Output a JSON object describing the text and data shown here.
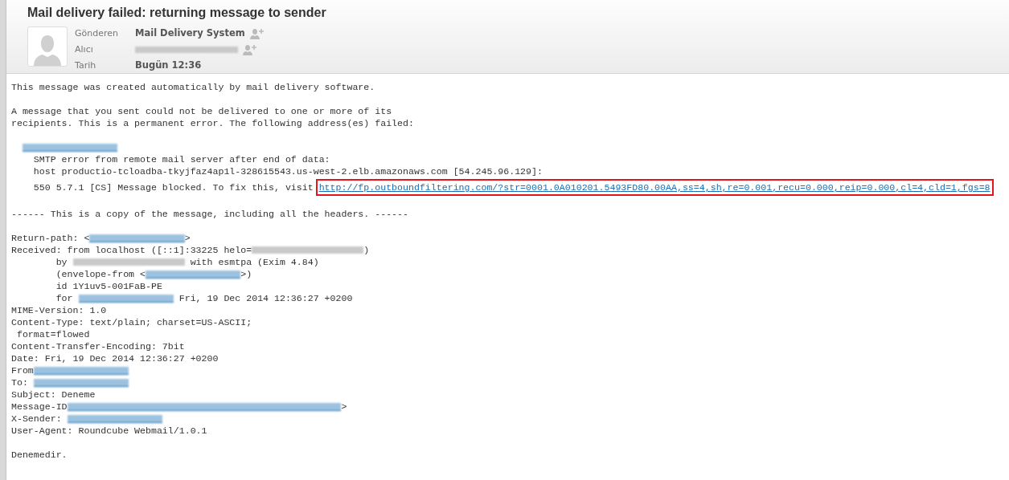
{
  "header": {
    "title": "Mail delivery failed: returning message to sender",
    "fields": [
      {
        "label": "Gönderen",
        "value": {
          "kind": "text",
          "text": "Mail Delivery System"
        },
        "add_contact": true
      },
      {
        "label": "Alıcı",
        "value": {
          "kind": "redacted_address"
        },
        "add_contact": true
      },
      {
        "label": "Tarih",
        "value": {
          "kind": "text",
          "text": "Bugün 12:36"
        },
        "add_contact": false
      }
    ]
  },
  "body": {
    "paragraphs": [
      {
        "lines": [
          [
            {
              "kind": "text",
              "text": "This message was created automatically by mail delivery software."
            }
          ]
        ]
      },
      {
        "lines": [
          [
            {
              "kind": "text",
              "text": "A message that you sent could not be delivered to one or more of its"
            }
          ],
          [
            {
              "kind": "text",
              "text": "recipients. This is a permanent error. The following address(es) failed:"
            }
          ]
        ]
      },
      {
        "lines": [
          {
            "indent": true,
            "segments": [
              {
                "kind": "redacted_address",
                "linked": true
              }
            ]
          },
          [
            {
              "kind": "text",
              "text": "    SMTP error from remote mail server after end of data:"
            }
          ],
          [
            {
              "kind": "text",
              "text": "    host productio-tcloadba-tkyjfaz4ap1l-328615543.us-west-2.elb.amazonaws.com [54.245.96.129]:"
            }
          ],
          [
            {
              "kind": "text",
              "text": "    550 5.7.1 [CS] Message blocked. To fix this, visit "
            },
            {
              "kind": "link",
              "text": "http://fp.outboundfiltering.com/?str=0001.0A010201.5493FD80.00AA,ss=4,sh,re=0.001,recu=0.000,reip=0.000,cl=4,cld=1,fgs=8",
              "highlighted": true
            }
          ]
        ]
      },
      {
        "lines": [
          [
            {
              "kind": "text",
              "text": "------ This is a copy of the message, including all the headers. ------"
            }
          ]
        ]
      },
      {
        "lines": [
          [
            {
              "kind": "text",
              "text": "Return-path: <"
            },
            {
              "kind": "redacted_address",
              "linked": true
            },
            {
              "kind": "text",
              "text": ">"
            }
          ],
          [
            {
              "kind": "text",
              "text": "Received: from localhost ([::1]:33225 helo="
            },
            {
              "kind": "redacted_host",
              "linked": false
            },
            {
              "kind": "text",
              "text": ")"
            }
          ],
          [
            {
              "kind": "text",
              "text": "        by "
            },
            {
              "kind": "redacted_host",
              "linked": false
            },
            {
              "kind": "text",
              "text": " with esmtpa (Exim 4.84)"
            }
          ],
          [
            {
              "kind": "text",
              "text": "        (envelope-from <"
            },
            {
              "kind": "redacted_address",
              "linked": true
            },
            {
              "kind": "text",
              "text": ">)"
            }
          ],
          [
            {
              "kind": "text",
              "text": "        id 1Y1uv5-001FaB-PE"
            }
          ],
          [
            {
              "kind": "text",
              "text": "        for "
            },
            {
              "kind": "redacted_address",
              "linked": true
            },
            {
              "kind": "text",
              "text": " Fri, 19 Dec 2014 12:36:27 +0200"
            }
          ],
          [
            {
              "kind": "text",
              "text": "MIME-Version: 1.0"
            }
          ],
          [
            {
              "kind": "text",
              "text": "Content-Type: text/plain; charset=US-ASCII;"
            }
          ],
          [
            {
              "kind": "text",
              "text": " format=flowed"
            }
          ],
          [
            {
              "kind": "text",
              "text": "Content-Transfer-Encoding: 7bit"
            }
          ],
          [
            {
              "kind": "text",
              "text": "Date: Fri, 19 Dec 2014 12:36:27 +0200"
            }
          ],
          [
            {
              "kind": "text",
              "text": "From"
            },
            {
              "kind": "redacted_address",
              "linked": true
            }
          ],
          [
            {
              "kind": "text",
              "text": "To: "
            },
            {
              "kind": "redacted_address",
              "linked": true
            }
          ],
          [
            {
              "kind": "text",
              "text": "Subject: Deneme"
            }
          ],
          [
            {
              "kind": "text",
              "text": "Message-ID"
            },
            {
              "kind": "redacted_id",
              "linked": true
            },
            {
              "kind": "text",
              "text": ">"
            }
          ],
          [
            {
              "kind": "text",
              "text": "X-Sender: "
            },
            {
              "kind": "redacted_address",
              "linked": true
            }
          ],
          [
            {
              "kind": "text",
              "text": "User-Agent: Roundcube Webmail/1.0.1"
            }
          ]
        ]
      },
      {
        "lines": [
          [
            {
              "kind": "text",
              "text": "Denemedir."
            }
          ]
        ]
      }
    ]
  }
}
